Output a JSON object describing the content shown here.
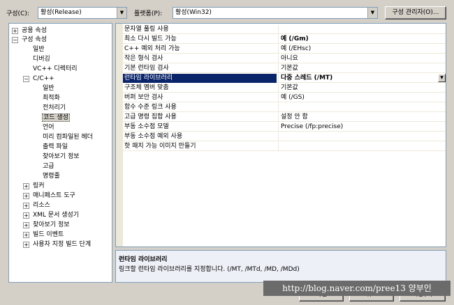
{
  "toolbar": {
    "config_label": "구성(C):",
    "config_value": "활성(Release)",
    "platform_label": "플랫폼(P):",
    "platform_value": "활성(Win32)",
    "config_manager_label": "구성 관리자(O)..."
  },
  "tree": {
    "common_props": "공용 속성",
    "config_props": "구성 속성",
    "general": "일반",
    "debugging": "디버깅",
    "vc_dirs": "VC++ 디렉터리",
    "cpp": "C/C++",
    "cpp_general": "일반",
    "optimization": "최적화",
    "preprocessor": "전처리기",
    "code_generation": "코드 생성",
    "language": "언어",
    "precompiled_headers": "미리 컴파일된 헤더",
    "output_files": "출력 파일",
    "browse_info": "찾아보기 정보",
    "advanced": "고급",
    "command_line": "명령줄",
    "linker": "링커",
    "manifest_tool": "매니페스트 도구",
    "resources": "리소스",
    "xml_doc": "XML 문서 생성기",
    "browse_info2": "찾아보기 정보",
    "build_events": "빌드 이벤트",
    "custom_build": "사용자 지정 빌드 단계"
  },
  "grid": {
    "rows": [
      {
        "name": "문자열 풀링 사용",
        "value": ""
      },
      {
        "name": "최소 다시 빌드 가능",
        "value": "예 (/Gm)"
      },
      {
        "name": "C++ 예외 처리 가능",
        "value": "예 (/EHsc)"
      },
      {
        "name": "작은 형식 검사",
        "value": "아니요"
      },
      {
        "name": "기본 런타임 검사",
        "value": "기본값"
      },
      {
        "name": "런타임 라이브러리",
        "value": "다중 스레드 (/MT)"
      },
      {
        "name": "구조체 멤버 맞춤",
        "value": "기본값"
      },
      {
        "name": "버퍼 보안 검사",
        "value": "예 (/GS)"
      },
      {
        "name": "함수 수준 링크 사용",
        "value": ""
      },
      {
        "name": "고급 명령 집합 사용",
        "value": "설정 안 함"
      },
      {
        "name": "부동 소수점 모델",
        "value": "Precise (/fp:precise)"
      },
      {
        "name": "부동 소수점 예외 사용",
        "value": ""
      },
      {
        "name": "핫 패치 가능 이미지 만들기",
        "value": ""
      }
    ]
  },
  "description": {
    "title": "런타임 라이브러리",
    "text": "링크할 런타임 라이브러리를 지정합니다.     (/MT, /MTd, /MD, /MDd)"
  },
  "buttons": {
    "ok": "확인",
    "cancel": "취소",
    "apply": "적용(A)"
  },
  "watermark": "http://blog.naver.com/pree13 양부인"
}
